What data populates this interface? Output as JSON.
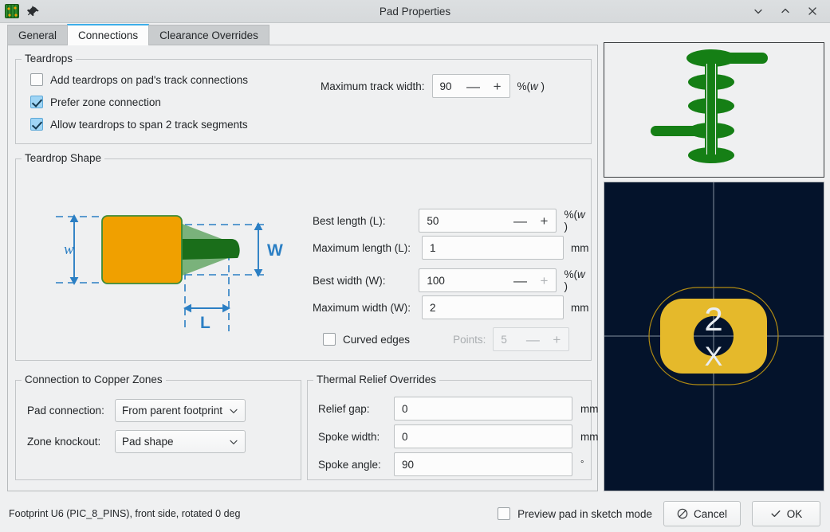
{
  "window": {
    "title": "Pad Properties",
    "app_icon": "kicad-pcb-icon",
    "pin_icon": "pin-icon",
    "controls": [
      {
        "name": "minimize-button",
        "icon": "chevron-down-icon"
      },
      {
        "name": "maximize-button",
        "icon": "chevron-up-icon"
      },
      {
        "name": "close-button",
        "icon": "close-icon"
      }
    ],
    "accent_color": "#3daee9",
    "background_color": "#eff0f1"
  },
  "tabs": [
    {
      "label": "General",
      "active": false
    },
    {
      "label": "Connections",
      "active": true
    },
    {
      "label": "Clearance Overrides",
      "active": false
    }
  ],
  "teardrops": {
    "legend": "Teardrops",
    "checkboxes": [
      {
        "label": "Add teardrops on pad's track connections",
        "checked": false
      },
      {
        "label": "Prefer zone connection",
        "checked": true
      },
      {
        "label": "Allow teardrops to span 2 track segments",
        "checked": true
      }
    ],
    "max_track_width": {
      "label": "Maximum track width:",
      "value": "90",
      "unit": "%(w )",
      "minus": "—",
      "plus": "+"
    }
  },
  "teardrop_shape": {
    "legend": "Teardrop Shape",
    "diagram": {
      "pad_color": "#f0a000",
      "pad_outline": "#3d8b37",
      "teardrop_color": "#1a6e1a",
      "dimension_color": "#2b7fc4",
      "labels": {
        "pad_width": "w",
        "teardrop_width": "W",
        "length": "L"
      }
    },
    "fields": [
      {
        "name": "best-length",
        "label": "Best length (L):",
        "value": "50",
        "unit": "%(w )",
        "spin": true,
        "plus_disabled": false
      },
      {
        "name": "maximum-length",
        "label": "Maximum length (L):",
        "value": "1",
        "unit": "mm",
        "spin": false
      },
      {
        "name": "best-width",
        "label": "Best width (W):",
        "value": "100",
        "unit": "%(w )",
        "spin": true,
        "plus_disabled": true
      },
      {
        "name": "maximum-width",
        "label": "Maximum width (W):",
        "value": "2",
        "unit": "mm",
        "spin": false
      }
    ],
    "curved_edges": {
      "label": "Curved edges",
      "checked": false
    },
    "points": {
      "label": "Points:",
      "value": "5",
      "enabled": false
    }
  },
  "copper_zones": {
    "legend": "Connection to Copper Zones",
    "rows": [
      {
        "label": "Pad connection:",
        "value": "From parent footprint"
      },
      {
        "label": "Zone knockout:",
        "value": "Pad shape"
      }
    ]
  },
  "thermal_relief": {
    "legend": "Thermal Relief Overrides",
    "rows": [
      {
        "label": "Relief gap:",
        "value": "0",
        "unit": "mm"
      },
      {
        "label": "Spoke width:",
        "value": "0",
        "unit": "mm"
      },
      {
        "label": "Spoke angle:",
        "value": "90",
        "unit": "°"
      }
    ]
  },
  "preview": {
    "stackup_color": "#157f15",
    "pad_color": "#e5b92b",
    "background_color": "#04132b",
    "pad_number": "2",
    "pad_marker": "X"
  },
  "footer": {
    "status": "Footprint U6 (PIC_8_PINS), front side, rotated 0 deg",
    "sketch_mode": {
      "label": "Preview pad in sketch mode",
      "checked": false
    },
    "cancel": "Cancel",
    "ok": "OK"
  }
}
